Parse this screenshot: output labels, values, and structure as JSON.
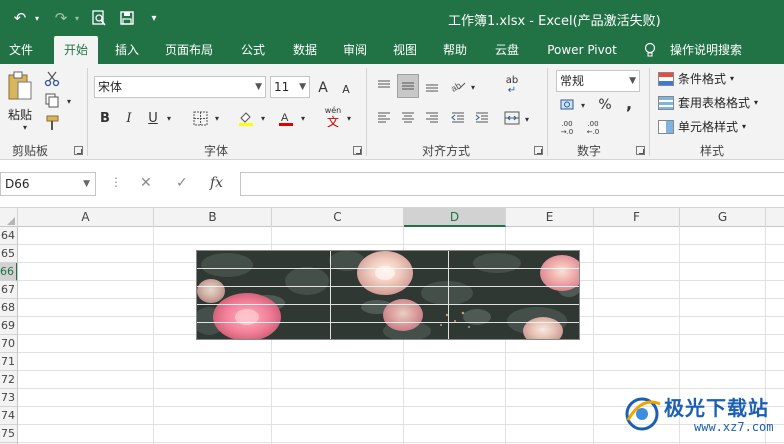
{
  "titlebar": {
    "title": "工作簿1.xlsx  -  Excel(产品激活失败)",
    "bg_color": "#217346",
    "quick_access": {
      "undo": "↶",
      "redo": "↷",
      "preview": "🔍",
      "save": "💾",
      "more": "▾"
    }
  },
  "tabs": [
    "文件",
    "开始",
    "插入",
    "页面布局",
    "公式",
    "数据",
    "审阅",
    "视图",
    "帮助",
    "云盘",
    "Power Pivot",
    "操作说明搜索"
  ],
  "active_tab": "开始",
  "ribbon": {
    "clipboard": {
      "paste": "粘贴",
      "label": "剪贴板"
    },
    "font": {
      "name": "宋体",
      "size": "11",
      "label": "字体",
      "bold": "B",
      "italic": "I",
      "underline": "U",
      "phonetic": "wén",
      "grow": "A",
      "shrink": "A"
    },
    "alignment": {
      "label": "对齐方式",
      "wrap": "ab"
    },
    "number": {
      "format": "常规",
      "label": "数字",
      "percent": "%",
      "comma": ",",
      "inc_decimal": ".00 →.0",
      "dec_decimal": ".00 ←.0"
    },
    "styles": {
      "label": "样式",
      "conditional": "条件格式",
      "table": "套用表格格式",
      "cell": "单元格样式"
    }
  },
  "formula_bar": {
    "name_box": "D66",
    "cancel": "✕",
    "enter": "✓",
    "fx": "fx",
    "value": ""
  },
  "columns": [
    "A",
    "B",
    "C",
    "D",
    "E",
    "F",
    "G"
  ],
  "selected_column": "D",
  "rows": [
    "64",
    "65",
    "66",
    "67",
    "68",
    "69",
    "70",
    "71",
    "72",
    "73",
    "74",
    "75"
  ],
  "selected_row": "66",
  "watermark": {
    "name": "极光下载站",
    "url": "www.xz7.com"
  }
}
